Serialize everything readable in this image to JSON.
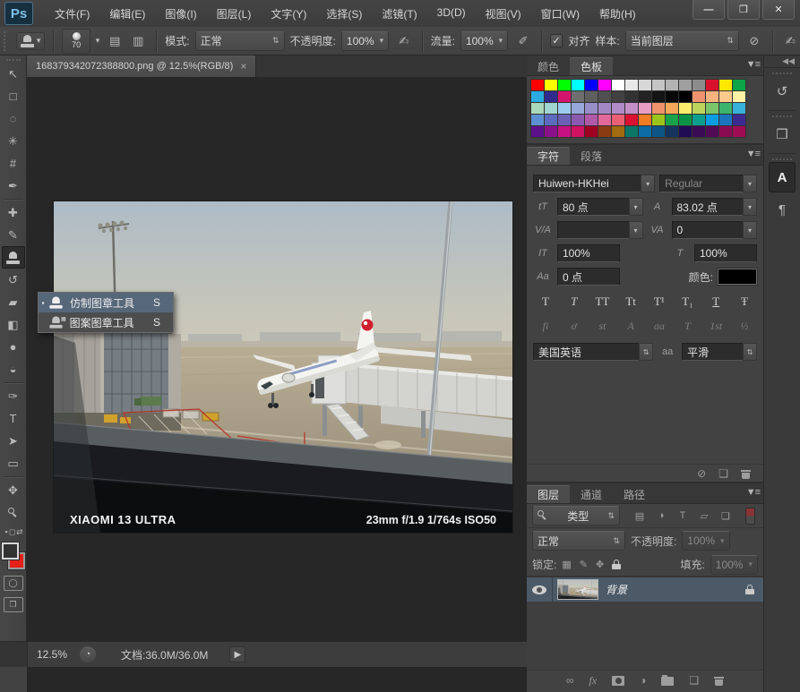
{
  "titlebar": {
    "logo": "Ps",
    "menus": [
      {
        "name": "menu-file",
        "glyph": "文件(F)"
      },
      {
        "name": "menu-edit",
        "glyph": "编辑(E)"
      },
      {
        "name": "menu-image",
        "glyph": "图像(I)"
      },
      {
        "name": "menu-layer",
        "glyph": "图层(L)"
      },
      {
        "name": "menu-type",
        "glyph": "文字(Y)"
      },
      {
        "name": "menu-select",
        "glyph": "选择(S)"
      },
      {
        "name": "menu-filter",
        "glyph": "滤镜(T)"
      },
      {
        "name": "menu-3d",
        "glyph": "3D(D)"
      },
      {
        "name": "menu-view",
        "glyph": "视图(V)"
      },
      {
        "name": "menu-window",
        "glyph": "窗口(W)"
      },
      {
        "name": "menu-help",
        "glyph": "帮助(H)"
      }
    ],
    "window_buttons": [
      {
        "name": "minimize-button",
        "glyph": "—"
      },
      {
        "name": "maximize-button",
        "glyph": "❐"
      },
      {
        "name": "close-button",
        "glyph": "✕"
      }
    ]
  },
  "options": {
    "brush_size": "70",
    "mode_label": "模式:",
    "mode_value": "正常",
    "opacity_label": "不透明度:",
    "opacity_value": "100%",
    "flow_label": "流量:",
    "flow_value": "100%",
    "align_label": "对齐",
    "sample_label": "样本:",
    "sample_value": "当前图层",
    "panel_icons": [
      {
        "name": "toggle-brush-panel-icon",
        "glyph": "▤"
      },
      {
        "name": "clone-source-panel-icon",
        "glyph": "▥"
      }
    ]
  },
  "doc_tab": {
    "title": "168379342072388800.png @ 12.5%(RGB/8)"
  },
  "tool_flyout": [
    {
      "label": "仿制图章工具",
      "shortcut": "S"
    },
    {
      "label": "图案图章工具",
      "shortcut": "S"
    }
  ],
  "toolbar": {
    "tools": [
      {
        "name": "move-tool",
        "glyph": "↖"
      },
      {
        "name": "marquee-tool",
        "glyph": "□"
      },
      {
        "name": "lasso-tool",
        "glyph": "◌"
      },
      {
        "name": "magic-wand-tool",
        "glyph": "✳"
      },
      {
        "name": "crop-tool",
        "glyph": "#"
      },
      {
        "name": "eyedropper-tool",
        "glyph": "✒"
      },
      {
        "divider": true
      },
      {
        "name": "healing-brush-tool",
        "glyph": "✚"
      },
      {
        "name": "brush-tool",
        "glyph": "✎"
      },
      {
        "name": "clone-stamp-tool",
        "stamp": true,
        "selected": true
      },
      {
        "name": "history-brush-tool",
        "glyph": "↺"
      },
      {
        "name": "eraser-tool",
        "glyph": "▰"
      },
      {
        "name": "paint-bucket-tool",
        "glyph": "◧"
      },
      {
        "name": "blur-tool",
        "glyph": "●"
      },
      {
        "name": "dodge-tool",
        "glyph": "◒"
      },
      {
        "divider": true
      },
      {
        "name": "pen-tool",
        "glyph": "✑"
      },
      {
        "name": "type-tool",
        "glyph": "T"
      },
      {
        "name": "path-select-tool",
        "glyph": "➤"
      },
      {
        "name": "shape-tool",
        "glyph": "▭"
      },
      {
        "divider": true
      },
      {
        "name": "hand-tool",
        "glyph": "✥"
      },
      {
        "name": "zoom-tool",
        "glyph": "",
        "cls": "has-mag"
      }
    ],
    "fg_color": "#333333",
    "bg_color": "#e32119"
  },
  "panels": {
    "swatches": {
      "tabs": [
        "颜色",
        "色板"
      ],
      "active_tab": "色板",
      "colors": [
        "#ff0000",
        "#ffff00",
        "#00ff00",
        "#00ffff",
        "#0000ff",
        "#ff00ff",
        "#ffffff",
        "#e8e8e8",
        "#d7d7d7",
        "#c5c5c5",
        "#b2b2b2",
        "#9f9f9f",
        "#8c8c8c",
        "#d8122c",
        "#fde900",
        "#0ca446",
        "#29abe2",
        "#312a8e",
        "#d4156e",
        "#6e6e6e",
        "#5f5f5f",
        "#505050",
        "#414141",
        "#323232",
        "#232323",
        "#141414",
        "#080808",
        "#000000",
        "#f0926e",
        "#f6b37d",
        "#fbca8c",
        "#fdf3a6",
        "#abd8ba",
        "#a0d4d0",
        "#9ccaee",
        "#99a8da",
        "#978ec8",
        "#a289c6",
        "#b18bc8",
        "#c490c5",
        "#e89ec3",
        "#f0936c",
        "#f5a75a",
        "#fbee6b",
        "#bcd45c",
        "#7cc46a",
        "#3db46d",
        "#38b1da",
        "#5c90d2",
        "#5c6bc0",
        "#6b60b6",
        "#8c59b1",
        "#b159a9",
        "#e16999",
        "#eb6075",
        "#da1130",
        "#f07c25",
        "#9bc51d",
        "#1aa34b",
        "#0b9448",
        "#0e9e8e",
        "#0c9ce2",
        "#1c74bc",
        "#3c2b91",
        "#5d108b",
        "#8b118b",
        "#c51181",
        "#d11161",
        "#a10121",
        "#8b3b11",
        "#a16b11",
        "#0d7565",
        "#0c6ca5",
        "#0c5585",
        "#15355f",
        "#200c55",
        "#3b0c55",
        "#510c55",
        "#8b0b53",
        "#a00c54"
      ]
    },
    "character": {
      "tabs": [
        "字符",
        "段落"
      ],
      "active_tab": "字符",
      "font_family": "Huiwen-HKHei",
      "font_style": "Regular",
      "size_icon": "tT",
      "size": "80 点",
      "leading_icon": "A",
      "leading": "83.02 点",
      "kerning_icon": "V/A",
      "kerning": "",
      "tracking_icon": "VA",
      "tracking": "0",
      "vscale_icon": "IT",
      "v_scale": "100%",
      "hscale_icon": "T",
      "h_scale": "100%",
      "baseline_icon": "Aa",
      "baseline": "0 点",
      "color_label": "颜色:",
      "style_buttons": [
        {
          "name": "faux-bold-button",
          "glyph": "T"
        },
        {
          "name": "faux-italic-button",
          "glyph": "T",
          "cls": "it"
        },
        {
          "name": "all-caps-button",
          "glyph": "TT"
        },
        {
          "name": "small-caps-button",
          "glyph": "Tt"
        },
        {
          "name": "superscript-button",
          "glyph": "T¹"
        },
        {
          "name": "subscript-button",
          "glyph": "T₁"
        },
        {
          "name": "underline-button",
          "glyph": "T",
          "cls": "ul"
        },
        {
          "name": "strikethrough-button",
          "glyph": "Ŧ"
        }
      ],
      "opentype_buttons": [
        {
          "name": "ligatures-button",
          "glyph": "fi",
          "dim": true
        },
        {
          "name": "contextual-alternates-button",
          "glyph": "ơ",
          "dim": true
        },
        {
          "name": "discretionary-ligatures-button",
          "glyph": "st",
          "dim": true
        },
        {
          "name": "swash-button",
          "glyph": "A",
          "dim": true
        },
        {
          "name": "stylistic-alternates-button",
          "glyph": "aa",
          "dim": true
        },
        {
          "name": "titling-alternates-button",
          "glyph": "T",
          "dim": true
        },
        {
          "name": "ordinals-button",
          "glyph": "1st",
          "dim": true
        },
        {
          "name": "fractions-button",
          "glyph": "½",
          "dim": true
        }
      ],
      "language": "美国英语",
      "antialias_icon": "aa",
      "antialias": "平滑",
      "group_bottom_icons": [
        {
          "name": "clear-override-icon",
          "glyph": "⊘"
        },
        {
          "name": "new-item-icon",
          "glyph": "❏"
        },
        {
          "name": "delete-item-icon",
          "glyph": "",
          "cls": "i-trash"
        }
      ]
    },
    "layers": {
      "tabs": [
        "图层",
        "通道",
        "路径"
      ],
      "active_tab": "图层",
      "filter_label": "类型",
      "filter_icons": [
        {
          "name": "filter-pixel-layers-icon",
          "glyph": "▤"
        },
        {
          "name": "filter-adjustment-layers-icon",
          "glyph": "◑"
        },
        {
          "name": "filter-type-layers-icon",
          "glyph": "T"
        },
        {
          "name": "filter-shape-layers-icon",
          "glyph": "▱"
        },
        {
          "name": "filter-smart-objects-icon",
          "glyph": "❏"
        }
      ],
      "blend_mode": "正常",
      "opacity_label": "不透明度:",
      "opacity_value": "100%",
      "lock_label": "锁定:",
      "lock_icons": [
        {
          "name": "lock-transparency-icon",
          "glyph": "▦"
        },
        {
          "name": "lock-pixels-icon",
          "glyph": "✎"
        },
        {
          "name": "lock-position-icon",
          "glyph": "✥"
        },
        {
          "name": "lock-all-icon",
          "glyph": "",
          "cls": "i-lock"
        }
      ],
      "fill_label": "填充:",
      "fill_value": "100%",
      "layer": {
        "name": "背景"
      },
      "bottom_icons": [
        {
          "name": "link-layers-icon",
          "glyph": "∞"
        },
        {
          "name": "layer-style-icon",
          "glyph": "fx",
          "cls": "fx"
        },
        {
          "name": "add-layer-mask-icon",
          "glyph": "",
          "cls": "i-mask"
        },
        {
          "name": "new-adjustment-layer-icon",
          "glyph": "◑"
        },
        {
          "name": "new-group-icon",
          "glyph": "",
          "cls": "i-folder"
        },
        {
          "name": "new-layer-icon",
          "glyph": "❏"
        },
        {
          "name": "delete-layer-icon",
          "glyph": "",
          "cls": "i-trash"
        }
      ]
    }
  },
  "dock": {
    "collapse": "◀◀",
    "history": "↺",
    "properties": "❒",
    "character": "A",
    "paragraph": "¶"
  },
  "status": {
    "zoom": "12.5%",
    "doc_info": "文档:36.0M/36.0M"
  },
  "photo": {
    "watermark_left": "XIAOMI 13 ULTRA",
    "watermark_right": "23mm  f/1.9  1/764s  ISO50"
  },
  "icons": {
    "bullet": "▪",
    "pattern": "▦",
    "dropdown": "▾",
    "spin": "⇅",
    "check": "✓",
    "prohibit": "⊘",
    "pressure": "✍",
    "airbrush": "✐",
    "collapse_right": "▶▶",
    "panel_menu": "▼≡",
    "close": "×",
    "flyout_arrow": "▶",
    "pie": "◔",
    "paragraph_mark": "¶"
  }
}
